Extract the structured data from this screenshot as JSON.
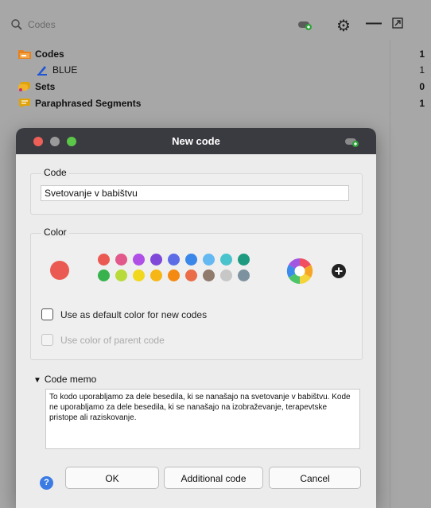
{
  "background": {
    "search_placeholder": "Codes",
    "rows": [
      {
        "label": "Codes",
        "count": "1"
      },
      {
        "label": "BLUE",
        "count": "1"
      },
      {
        "label": "Sets",
        "count": "0"
      },
      {
        "label": "Paraphrased Segments",
        "count": "1"
      }
    ],
    "colors": {
      "codes_folder": "#e7831e",
      "blue_pen": "#1f56d6",
      "sets": "#e0a30a",
      "paraphrased": "#e0a30a"
    }
  },
  "dialog": {
    "title": "New code",
    "code_group_label": "Code",
    "code_value": "Svetovanje v babištvu",
    "color_group_label": "Color",
    "current_color": "#ea5a52",
    "swatches_row1": [
      "#ea5a52",
      "#e2588a",
      "#b04fe6",
      "#7f48d8",
      "#5b6ce6",
      "#3b86e9",
      "#64b9f2",
      "#49c4cc",
      "#1e9a80"
    ],
    "swatches_row2": [
      "#37b24d",
      "#b8db3a",
      "#f1d81e",
      "#f6b615",
      "#f48a12",
      "#ea6d48",
      "#8f7a6c",
      "#c7c7c7",
      "#7d929f"
    ],
    "default_color_label": "Use as default color for new codes",
    "parent_color_label": "Use color of parent code",
    "memo_label": "Code memo",
    "memo_text": "To kodo uporabljamo za dele besedila, ki se nanašajo na svetovanje v babištvu. Kode ne uporabljamo za dele besedila, ki se nanašajo na izobraževanje, terapevtske pristope ali raziskovanje.",
    "ok_label": "OK",
    "additional_label": "Additional code",
    "cancel_label": "Cancel",
    "help_glyph": "?"
  },
  "window_controls": {
    "close": "#ed5f57",
    "minimize": "#9a9a9a",
    "zoom": "#5bc648"
  }
}
